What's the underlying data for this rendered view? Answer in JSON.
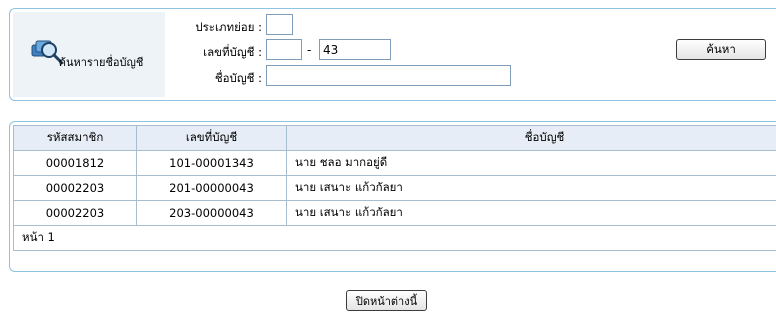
{
  "search": {
    "title": "ค้นหารายชื่อบัญชี",
    "subtype_label": "ประเภทย่อย :",
    "subtype_value": "",
    "account_no_label": "เลขที่บัญชี :",
    "account_no_prefix": "",
    "account_no_separator": "-",
    "account_no_suffix": "43",
    "account_name_label": "ชื่อบัญชี :",
    "account_name_value": "",
    "search_button": "ค้นหา"
  },
  "results": {
    "columns": [
      "รหัสสมาชิก",
      "เลขที่บัญชี",
      "ชื่อบัญชี"
    ],
    "rows": [
      {
        "member_id": "00001812",
        "account_no": "101-00001343",
        "account_name": "นาย ชลอ มากอยู่ดี"
      },
      {
        "member_id": "00002203",
        "account_no": "201-00000043",
        "account_name": "นาย เสนาะ แก้วกัลยา"
      },
      {
        "member_id": "00002203",
        "account_no": "203-00000043",
        "account_name": "นาย เสนาะ แก้วกัลยา"
      }
    ],
    "page_label": "หน้า 1"
  },
  "footer": {
    "close_button": "ปิดหน้าต่างนี้"
  },
  "colors": {
    "panel_border": "#8fc3e0",
    "header_bg": "#e6edf6",
    "title_cell_bg": "#eef3f8"
  }
}
